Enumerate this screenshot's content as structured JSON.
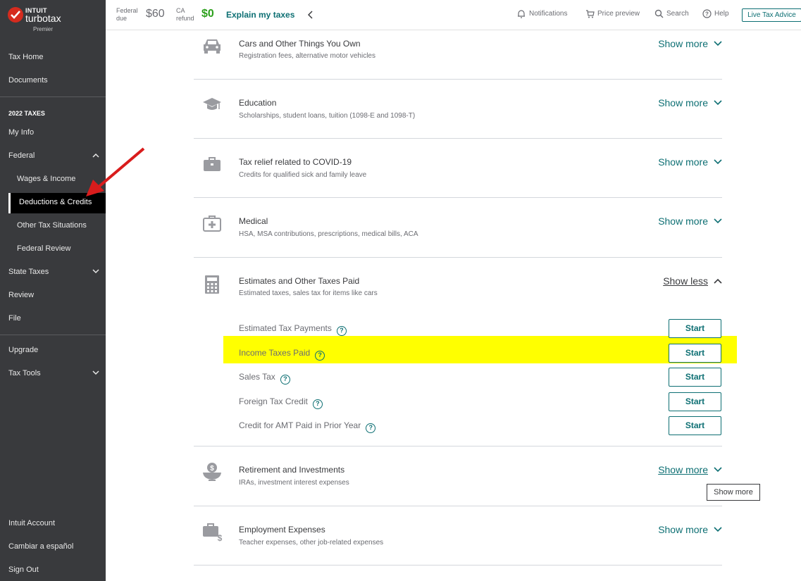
{
  "brand": {
    "intuit": "INTUIT",
    "turbotax": "turbotax",
    "edition": "Premier"
  },
  "sidebar": {
    "top_items": [
      {
        "label": "Tax Home"
      },
      {
        "label": "Documents"
      }
    ],
    "section_title": "2022 TAXES",
    "my_info": "My Info",
    "federal": "Federal",
    "federal_sub": [
      {
        "label": "Wages & Income"
      },
      {
        "label": "Deductions & Credits"
      },
      {
        "label": "Other Tax Situations"
      },
      {
        "label": "Federal Review"
      }
    ],
    "state_taxes": "State Taxes",
    "review": "Review",
    "file": "File",
    "upgrade": "Upgrade",
    "tax_tools": "Tax Tools",
    "bottom_items": [
      {
        "label": "Intuit Account"
      },
      {
        "label": "Cambiar a español"
      },
      {
        "label": "Sign Out"
      }
    ]
  },
  "topbar": {
    "federal_label_1": "Federal",
    "federal_label_2": "due",
    "federal_amount": "$60",
    "ca_label_1": "CA",
    "ca_label_2": "refund",
    "ca_amount": "$0",
    "explain": "Explain my taxes",
    "notifications": "Notifications",
    "price_preview": "Price preview",
    "search": "Search",
    "help": "Help",
    "live_tax_advice": "Live Tax Advice",
    "colors": {
      "due": "#6b6c72",
      "refund": "#2ca01c",
      "accent": "#0d6f73"
    }
  },
  "categories": [
    {
      "icon": "car-icon",
      "title": "Cars and Other Things You Own",
      "subtitle": "Registration fees, alternative motor vehicles",
      "toggle": "Show more"
    },
    {
      "icon": "graduation-cap-icon",
      "title": "Education",
      "subtitle": "Scholarships, student loans, tuition (1098-E and 1098-T)",
      "toggle": "Show more"
    },
    {
      "icon": "briefcase-icon",
      "title": "Tax relief related to COVID-19",
      "subtitle": "Credits for qualified sick and family leave",
      "toggle": "Show more"
    },
    {
      "icon": "medical-kit-icon",
      "title": "Medical",
      "subtitle": "HSA, MSA contributions, prescriptions, medical bills, ACA",
      "toggle": "Show more"
    },
    {
      "icon": "calculator-icon",
      "title": "Estimates and Other Taxes Paid",
      "subtitle": "Estimated taxes, sales tax for items like cars",
      "toggle": "Show less"
    },
    {
      "icon": "money-bowl-icon",
      "title": "Retirement and Investments",
      "subtitle": "IRAs, investment interest expenses",
      "toggle": "Show more"
    },
    {
      "icon": "briefcase-dollar-icon",
      "title": "Employment Expenses",
      "subtitle": "Teacher expenses, other job-related expenses",
      "toggle": "Show more"
    }
  ],
  "estimates_items": [
    {
      "label": "Estimated Tax Payments",
      "button": "Start"
    },
    {
      "label": "Income Taxes Paid",
      "button": "Start"
    },
    {
      "label": "Sales Tax",
      "button": "Start"
    },
    {
      "label": "Foreign Tax Credit",
      "button": "Start"
    },
    {
      "label": "Credit for AMT Paid in Prior Year",
      "button": "Start"
    }
  ],
  "help_glyph": "?",
  "tooltip": "Show more",
  "highlight_color": "#ffff00"
}
